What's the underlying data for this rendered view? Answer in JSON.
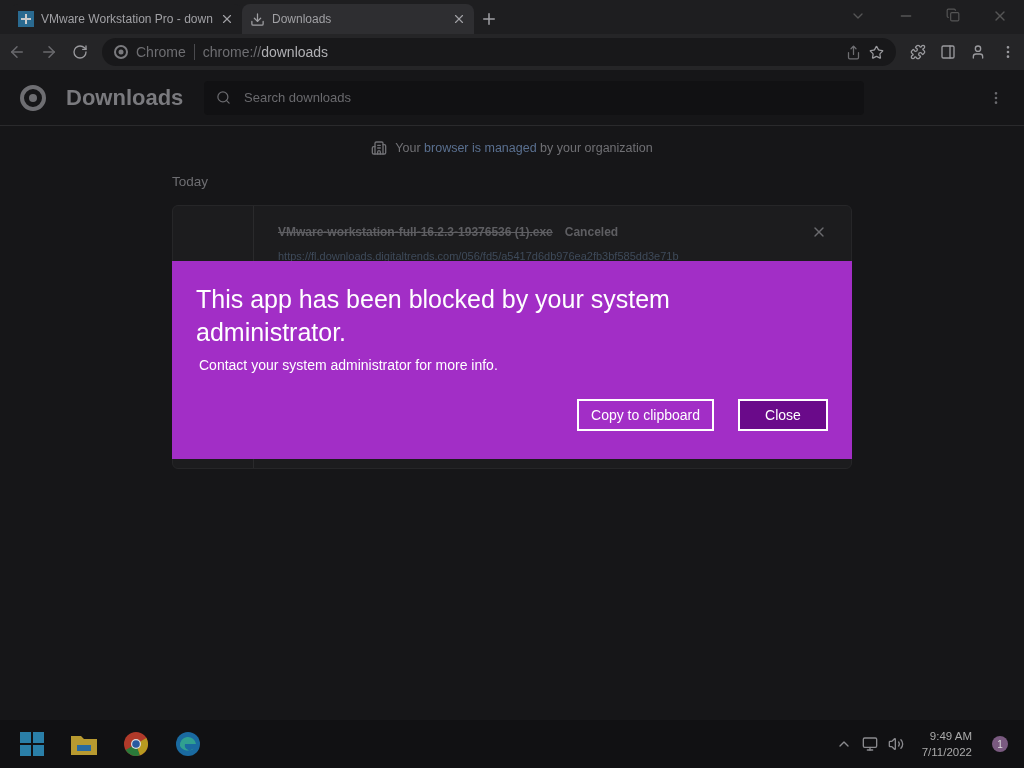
{
  "tabs": [
    {
      "title": "VMware Workstation Pro - down",
      "selected": false,
      "kind": "app"
    },
    {
      "title": "Downloads",
      "selected": true,
      "kind": "download"
    }
  ],
  "address_bar": {
    "site_label": "Chrome",
    "url_prefix": "chrome://",
    "url_path": "downloads"
  },
  "downloads_page": {
    "title": "Downloads",
    "search": {
      "placeholder": "Search downloads"
    },
    "managed_notice": {
      "before": "Your ",
      "link": "browser is managed",
      "after": " by your organization"
    },
    "section": "Today",
    "items": [
      {
        "file_name": "VMware-workstation-full-16.2.3-19376536 (1).exe",
        "status": "Canceled",
        "canceled": true,
        "url": "https://fl.downloads.digitaltrends.com/056/fd5/a5417d6db976ea2fb3bf585dd3e71b"
      }
    ]
  },
  "dialog": {
    "title": "This app has been blocked by your system administrator.",
    "message": "Contact your system administrator for more info.",
    "buttons": [
      {
        "label": "Copy to clipboard",
        "selected": false
      },
      {
        "label": "Close",
        "selected": true
      }
    ]
  },
  "taskbar": {
    "apps": [
      {
        "kind": "start"
      },
      {
        "kind": "folder"
      },
      {
        "kind": "chrome"
      },
      {
        "kind": "edge"
      }
    ],
    "time": "9:49 AM",
    "date": "7/11/2022",
    "notifications": "1"
  }
}
